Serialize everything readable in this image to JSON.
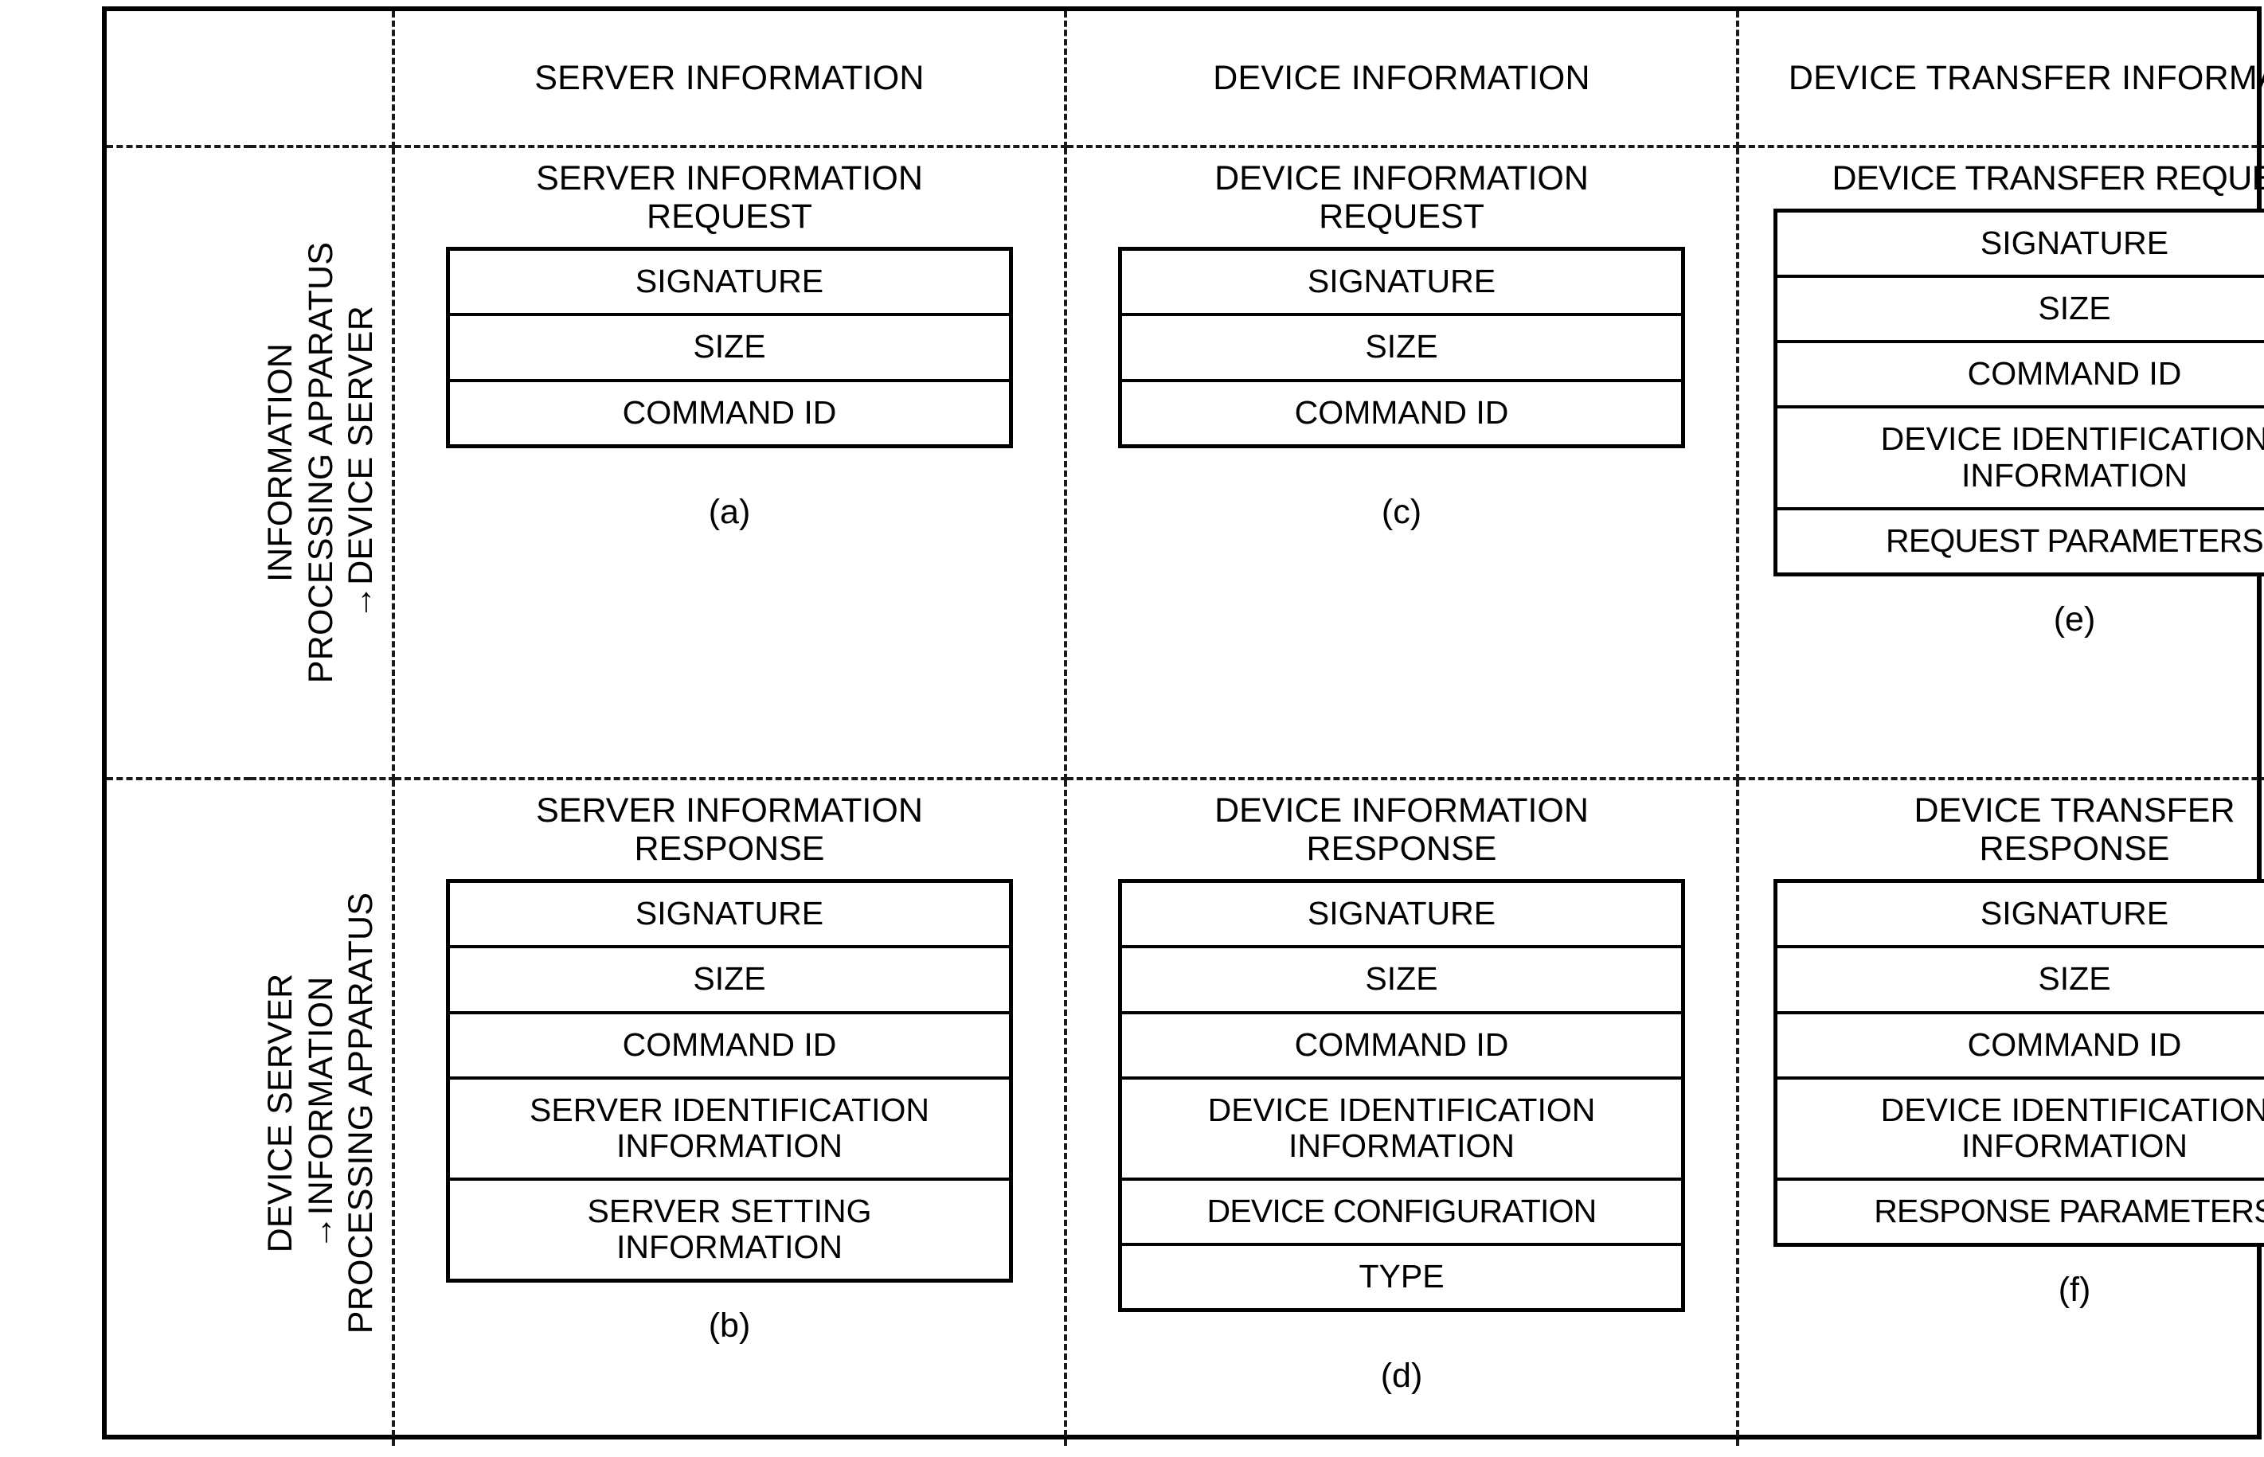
{
  "figure": {
    "column_headers": [
      "SERVER INFORMATION",
      "DEVICE INFORMATION",
      "DEVICE TRANSFER\nINFORMATION"
    ],
    "row_labels": [
      {
        "lines": [
          "INFORMATION",
          "PROCESSING APPARATUS",
          "→DEVICE SERVER"
        ]
      },
      {
        "lines": [
          "DEVICE SERVER",
          "→INFORMATION",
          "PROCESSING APPARATUS"
        ]
      }
    ],
    "cells": {
      "a": {
        "letter": "(a)",
        "title": "SERVER INFORMATION\nREQUEST",
        "fields": [
          "SIGNATURE",
          "SIZE",
          "COMMAND ID"
        ]
      },
      "c": {
        "letter": "(c)",
        "title": "DEVICE INFORMATION\nREQUEST",
        "fields": [
          "SIGNATURE",
          "SIZE",
          "COMMAND ID"
        ]
      },
      "e": {
        "letter": "(e)",
        "title": "DEVICE TRANSFER REQUEST",
        "fields": [
          "SIGNATURE",
          "SIZE",
          "COMMAND ID",
          "DEVICE IDENTIFICATION\nINFORMATION",
          "REQUEST PARAMETERS"
        ]
      },
      "b": {
        "letter": "(b)",
        "title": "SERVER INFORMATION\nRESPONSE",
        "fields": [
          "SIGNATURE",
          "SIZE",
          "COMMAND ID",
          "SERVER IDENTIFICATION\nINFORMATION",
          "SERVER SETTING\nINFORMATION"
        ]
      },
      "d": {
        "letter": "(d)",
        "title": "DEVICE INFORMATION\nRESPONSE",
        "fields": [
          "SIGNATURE",
          "SIZE",
          "COMMAND ID",
          "DEVICE IDENTIFICATION\nINFORMATION",
          "DEVICE CONFIGURATION",
          "TYPE"
        ]
      },
      "f": {
        "letter": "(f)",
        "title": "DEVICE TRANSFER\nRESPONSE",
        "fields": [
          "SIGNATURE",
          "SIZE",
          "COMMAND ID",
          "DEVICE IDENTIFICATION\nINFORMATION",
          "RESPONSE PARAMETERS"
        ]
      }
    }
  }
}
